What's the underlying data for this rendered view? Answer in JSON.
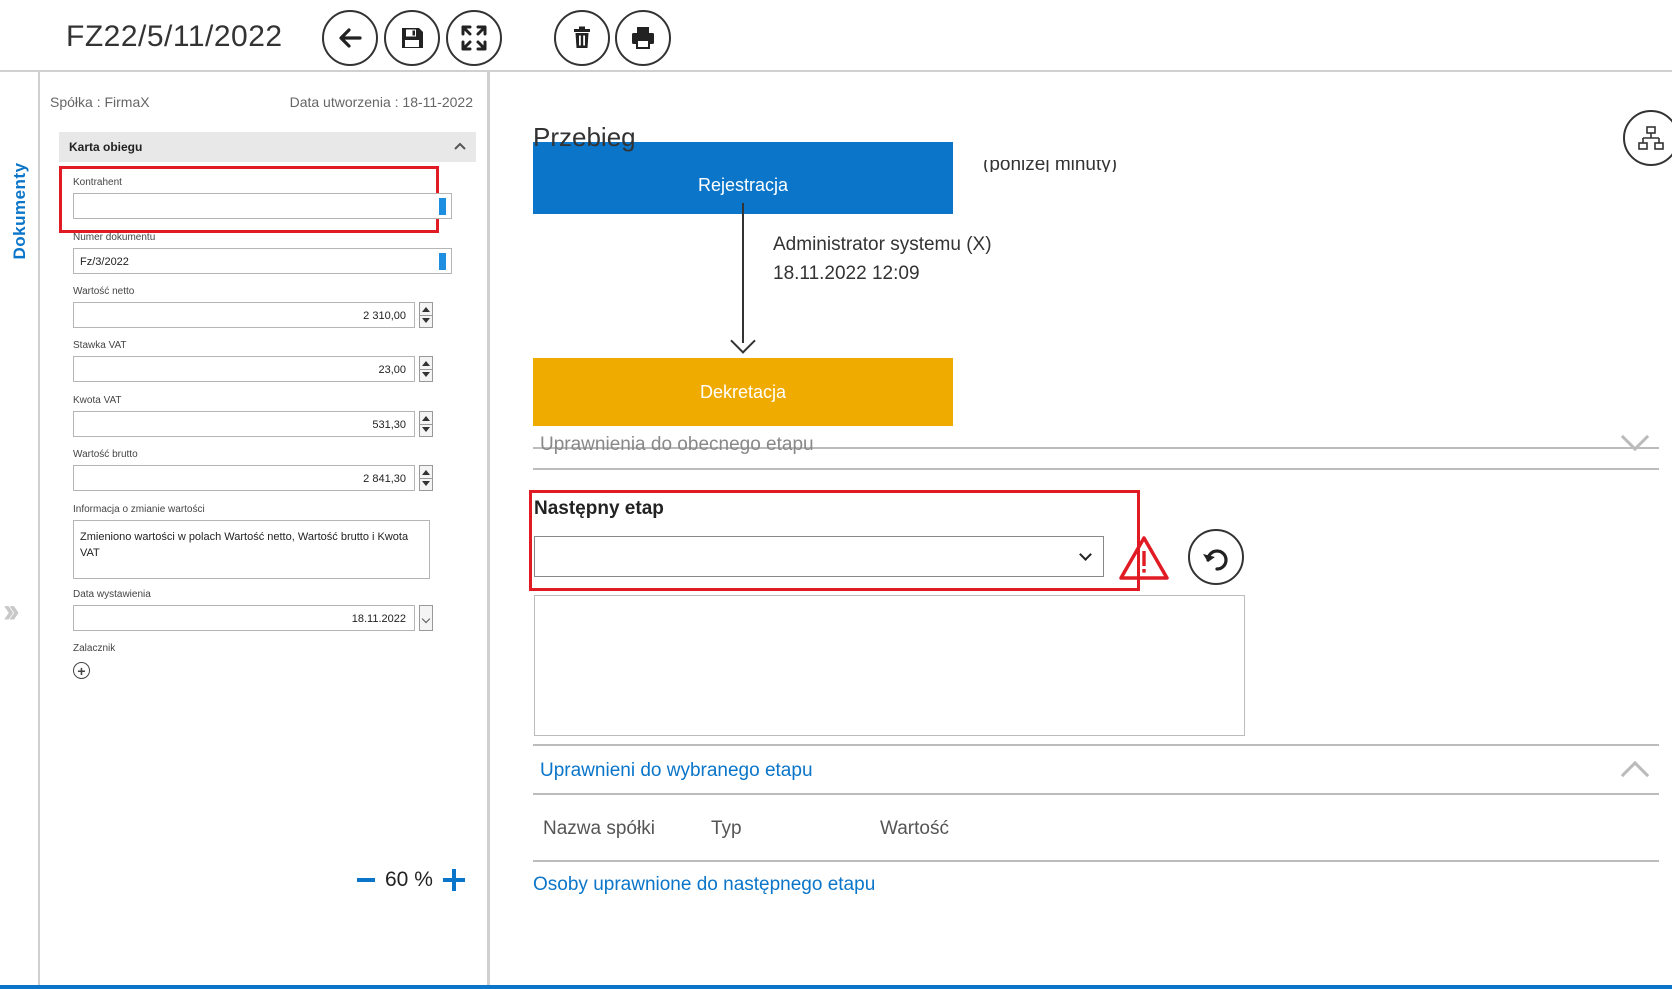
{
  "header": {
    "doc_title": "FZ22/5/11/2022",
    "buttons": [
      "back",
      "save",
      "fullscreen",
      "delete",
      "print"
    ]
  },
  "sidebar": {
    "vertical_tab": "Dokumenty"
  },
  "left": {
    "company": "Spółka : FirmaX",
    "created": "Data utworzenia : 18-11-2022",
    "section_title": "Karta obiegu",
    "fields": {
      "kontrahent": {
        "label": "Kontrahent",
        "value": ""
      },
      "numer": {
        "label": "Numer dokumentu",
        "value": "Fz/3/2022"
      },
      "netto": {
        "label": "Wartość netto",
        "value": "2 310,00"
      },
      "vat_rate": {
        "label": "Stawka VAT",
        "value": "23,00"
      },
      "vat_amount": {
        "label": "Kwota VAT",
        "value": "531,30"
      },
      "brutto": {
        "label": "Wartość brutto",
        "value": "2 841,30"
      },
      "info": {
        "label": "Informacja o zmianie wartości",
        "value": "Zmieniono wartości w polach Wartość netto, Wartość brutto i Kwota VAT"
      },
      "date": {
        "label": "Data wystawienia",
        "value": "18.11.2022"
      },
      "attachment": {
        "label": "Zalacznik"
      }
    },
    "zoom": "60 %"
  },
  "right": {
    "title": "Przebieg",
    "step1": "Rejestracja",
    "step1_note": "(poniżej minuty)",
    "actor": "Administrator systemu (X)",
    "actor_time": "18.11.2022 12:09",
    "step2": "Dekretacja",
    "acc_current": "Uprawnienia do obecnego etapu",
    "next_stage_label": "Następny etap",
    "next_stage_value": "",
    "acc_selected": "Uprawnieni do wybranego etapu",
    "columns": [
      "Nazwa spółki",
      "Typ",
      "Wartość"
    ],
    "link_next": "Osoby uprawnione do następnego etapu"
  },
  "colors": {
    "accent_blue": "#0a75c9",
    "step_orange": "#f0ab00",
    "highlight_red": "#e01b24"
  }
}
